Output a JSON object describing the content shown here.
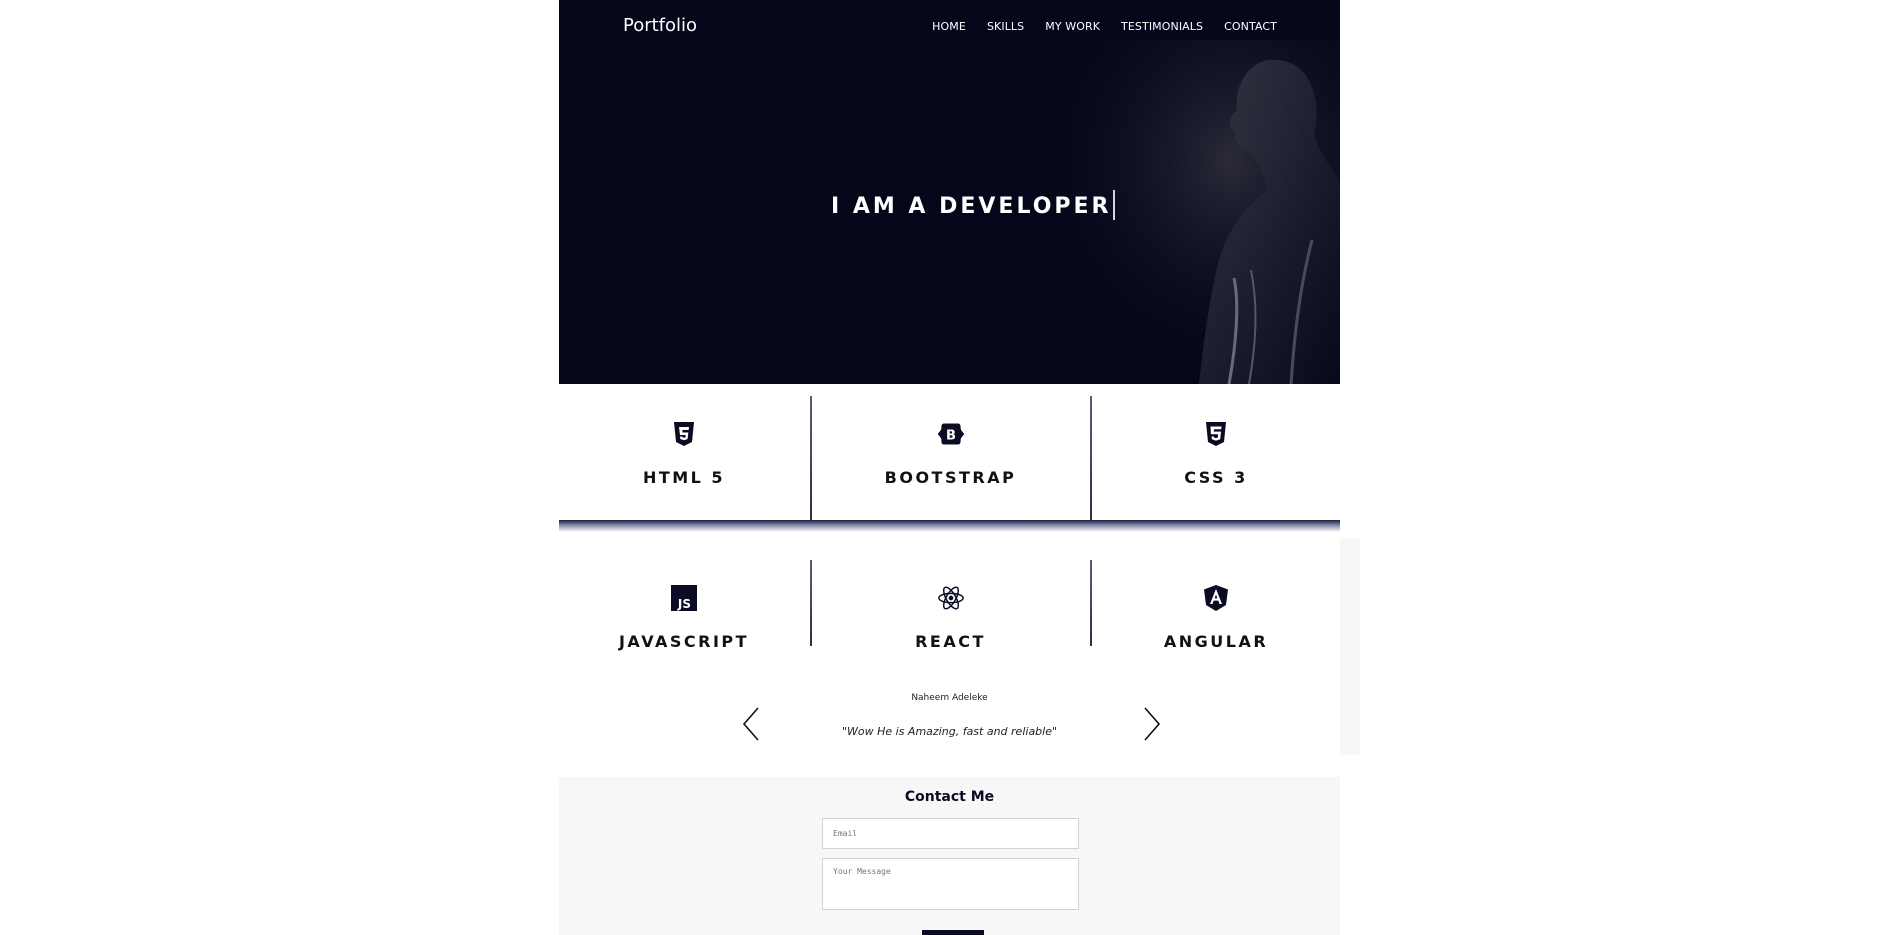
{
  "header": {
    "brand": "Portfolio",
    "nav": [
      "HOME",
      "SKILLS",
      "MY WORK",
      "TESTIMONIALS",
      "CONTACT"
    ]
  },
  "hero": {
    "title": "I AM A DEVELOPER"
  },
  "skills": [
    {
      "label": "HTML 5",
      "icon": "html5-icon"
    },
    {
      "label": "BOOTSTRAP",
      "icon": "bootstrap-icon"
    },
    {
      "label": "CSS 3",
      "icon": "css3-icon"
    },
    {
      "label": "JAVASCRIPT",
      "icon": "javascript-icon"
    },
    {
      "label": "REACT",
      "icon": "react-icon"
    },
    {
      "label": "ANGULAR",
      "icon": "angular-icon"
    }
  ],
  "testimonial": {
    "name": "Naheem Adeleke",
    "quote": "\"Wow He is Amazing, fast and reliable\""
  },
  "contact": {
    "title": "Contact Me",
    "email_placeholder": "Email",
    "message_placeholder": "Your Message"
  },
  "colors": {
    "navy": "#05061a",
    "accent": "#0b0c24",
    "panel": "#f7f7f7"
  }
}
